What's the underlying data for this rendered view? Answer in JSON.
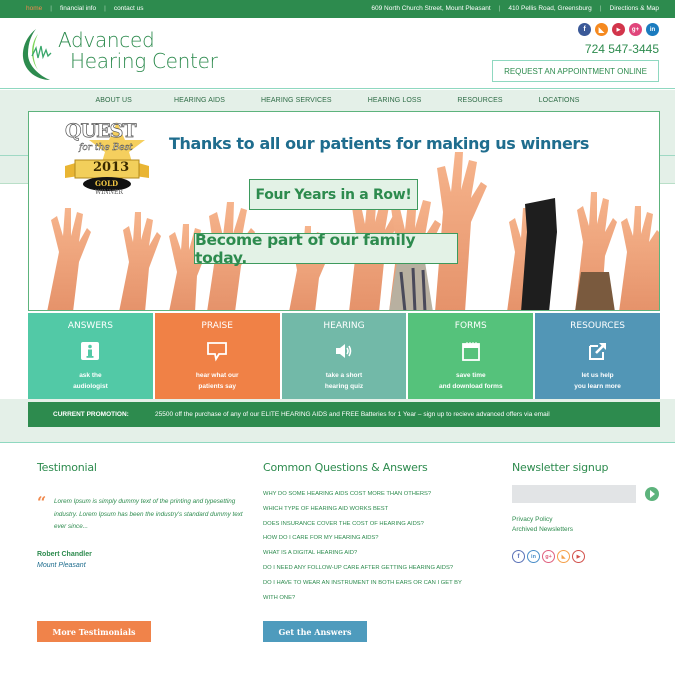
{
  "topbar": {
    "links": [
      "home",
      "financial info",
      "contact us"
    ],
    "active": "home",
    "addresses": [
      "609 North Church Street, Mount Pleasant",
      "410 Pellis Road, Greensburg",
      "Directions & Map"
    ]
  },
  "header": {
    "logo_line1": "Advanced",
    "logo_line2": "Hearing Center",
    "phone": "724 547-3445",
    "appointment_button": "REQUEST AN APPOINTMENT ONLINE",
    "social": [
      {
        "name": "facebook",
        "glyph": "f",
        "color": "#3b5998"
      },
      {
        "name": "rss",
        "glyph": "◣",
        "color": "#f5891f"
      },
      {
        "name": "youtube",
        "glyph": "▶",
        "color": "#d2354b"
      },
      {
        "name": "google-plus",
        "glyph": "g+",
        "color": "#e0457b"
      },
      {
        "name": "linkedin",
        "glyph": "in",
        "color": "#1a7bbf"
      }
    ]
  },
  "nav": {
    "items": [
      "ABOUT US",
      "HEARING AIDS",
      "HEARING SERVICES",
      "HEARING LOSS",
      "RESOURCES",
      "LOCATIONS"
    ]
  },
  "hero": {
    "title": "Thanks to all our patients for making us winners",
    "tagline1": "Four Years in a Row!",
    "tagline2": "Become part of our family today.",
    "award": {
      "line1": "QUEST",
      "line2": "for the Best",
      "year": "2013",
      "level": "GOLD",
      "label": "WINNER"
    }
  },
  "tiles": [
    {
      "title": "ANSWERS",
      "icon": "info-icon",
      "sub1": "ask the",
      "sub2": "audiologist",
      "color": "#52c9a6"
    },
    {
      "title": "PRAISE",
      "icon": "speech-bubble-icon",
      "sub1": "hear what our",
      "sub2": "patients say",
      "color": "#f08146"
    },
    {
      "title": "HEARING",
      "icon": "speaker-icon",
      "sub1": "take a short",
      "sub2": "hearing quiz",
      "color": "#72b9a8"
    },
    {
      "title": "FORMS",
      "icon": "calendar-form-icon",
      "sub1": "save time",
      "sub2": "and download forms",
      "color": "#55c27b"
    },
    {
      "title": "RESOURCES",
      "icon": "external-link-icon",
      "sub1": "let us help",
      "sub2": "you learn more",
      "color": "#5296b6"
    }
  ],
  "promo": {
    "label": "CURRENT PROMOTION:",
    "text": "25500 off the purchase of any of our ELITE HEARING AIDS and FREE Batteries for 1 Year – sign up to recieve advanced offers via email"
  },
  "testimonial": {
    "heading": "Testimonial",
    "quote": "Lorem Ipsum is simply dummy text of the printing and typesetting industry. Lorem Ipsum has been the industry's standard dummy text ever since...",
    "author": "Robert Chandler",
    "location": "Mount Pleasant",
    "button": "More Testimonials"
  },
  "qa": {
    "heading": "Common Questions & Answers",
    "items": [
      "WHY DO SOME HEARING AIDS COST MORE THAN OTHERS?",
      "WHICH TYPE OF HEARING AID WORKS BEST",
      "DOES INSURANCE COVER THE COST OF HEARING AIDS?",
      "HOW DO I CARE FOR MY HEARING AIDS?",
      "WHAT IS A DIGITAL HEARING AID?",
      "DO I NEED ANY FOLLOW-UP CARE AFTER GETTING HEARING AIDS?",
      "DO I HAVE TO WEAR AN INSTRUMENT IN BOTH EARS OR CAN I GET BY",
      "WITH ONE?"
    ],
    "button": "Get the Answers"
  },
  "newsletter": {
    "heading": "Newsletter signup",
    "input_value": "",
    "links": [
      "Privacy Policy",
      "Archived Newsletters"
    ],
    "social": [
      {
        "name": "facebook",
        "glyph": "f",
        "color": "#5b73b8"
      },
      {
        "name": "linkedin",
        "glyph": "in",
        "color": "#4a8ec9"
      },
      {
        "name": "google-plus",
        "glyph": "g+",
        "color": "#e0607e"
      },
      {
        "name": "rss",
        "glyph": "◣",
        "color": "#f5a04a"
      },
      {
        "name": "youtube",
        "glyph": "▶",
        "color": "#d2504b"
      }
    ]
  }
}
